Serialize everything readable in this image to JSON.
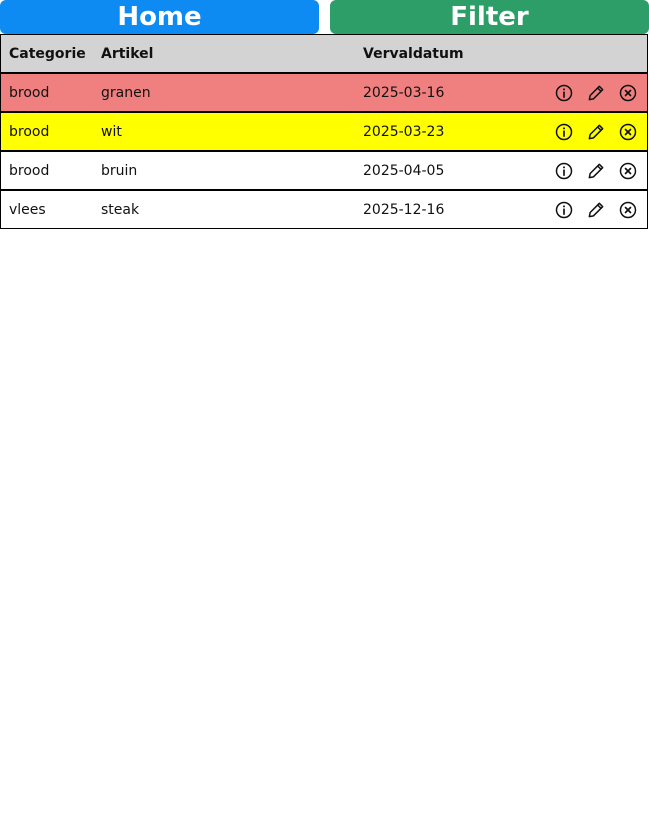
{
  "nav": {
    "home_label": "Home",
    "filter_label": "Filter"
  },
  "colors": {
    "home_button": "#0d8bf2",
    "filter_button": "#2e9e68",
    "header_bg": "#d3d3d3",
    "row_expired": "#f08080",
    "row_soon": "#ffff00",
    "row_ok": "#ffffff"
  },
  "table": {
    "headers": {
      "category": "Categorie",
      "item": "Artikel",
      "expiry": "Vervaldatum"
    },
    "rows": [
      {
        "category": "brood",
        "item": "granen",
        "expiry": "2025-03-16",
        "status": "expired"
      },
      {
        "category": "brood",
        "item": "wit",
        "expiry": "2025-03-23",
        "status": "soon"
      },
      {
        "category": "brood",
        "item": "bruin",
        "expiry": "2025-04-05",
        "status": "ok"
      },
      {
        "category": "vlees",
        "item": "steak",
        "expiry": "2025-12-16",
        "status": "ok"
      }
    ],
    "action_icons": [
      "info-icon",
      "pencil-icon",
      "close-circle-icon"
    ]
  }
}
